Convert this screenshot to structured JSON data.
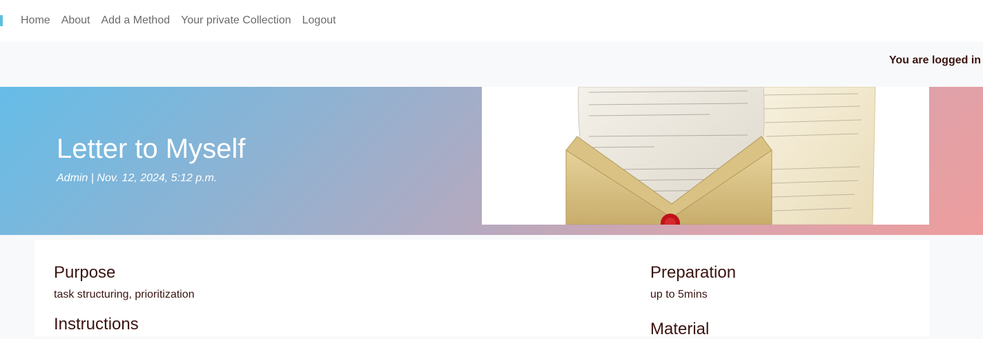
{
  "nav": {
    "links": [
      "Home",
      "About",
      "Add a Method",
      "Your private Collection",
      "Logout"
    ]
  },
  "status": {
    "login_text": "You are logged in"
  },
  "hero": {
    "title": "Letter to Myself",
    "meta": "Admin | Nov. 12, 2024, 5:12 p.m.",
    "image_icon": "letter-envelope-icon"
  },
  "method": {
    "purpose_heading": "Purpose",
    "purpose_text": "task structuring, prioritization",
    "instructions_heading": "Instructions",
    "preparation_heading": "Preparation",
    "preparation_text": "up to 5mins",
    "material_heading": "Material"
  },
  "colors": {
    "accent": "#5bc0de",
    "hero_gradient_start": "#65bde8",
    "hero_gradient_end": "#ee9d9d",
    "text_dark": "#3a1410"
  }
}
